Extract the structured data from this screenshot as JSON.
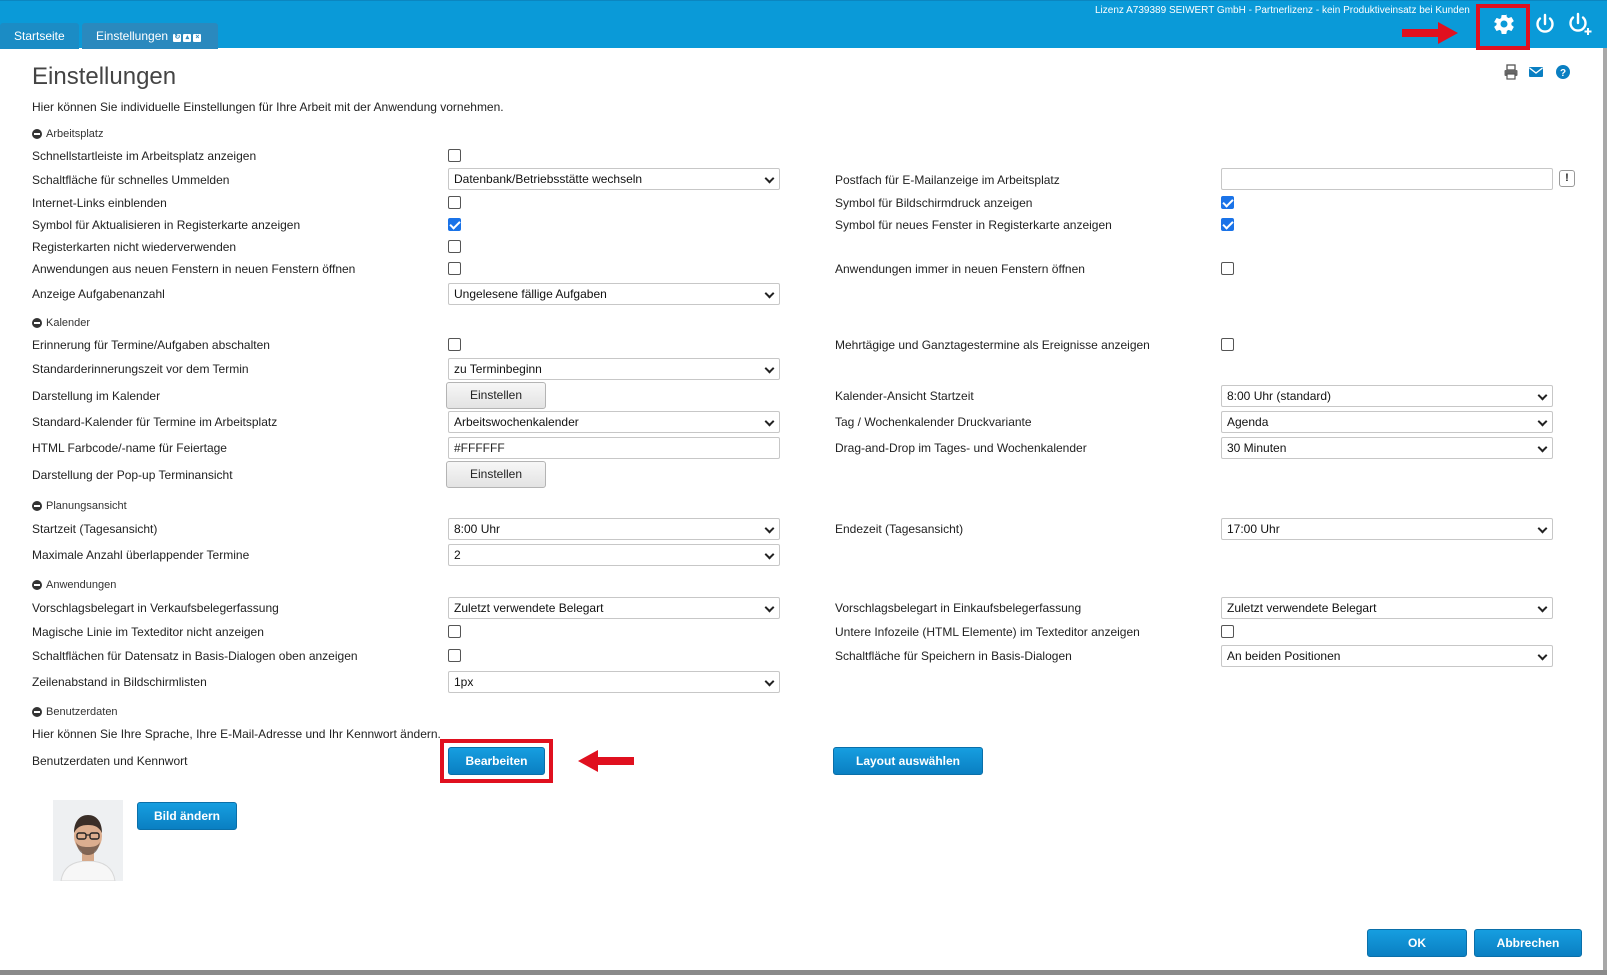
{
  "license_text": "Lizenz A739389 SEIWERT GmbH - Partnerlizenz - kein Produktiveinsatz bei Kunden",
  "tabs": [
    {
      "label": "Startseite"
    },
    {
      "label": "Einstellungen"
    }
  ],
  "header": {
    "title": "Einstellungen",
    "description": "Hier können Sie individuelle Einstellungen für Ihre Arbeit mit der Anwendung vornehmen."
  },
  "sections": {
    "arbeitsplatz": "Arbeitsplatz",
    "kalender": "Kalender",
    "planung": "Planungsansicht",
    "anwendungen": "Anwendungen",
    "benutzer": "Benutzerdaten"
  },
  "rows": {
    "schnellstart": {
      "label": "Schnellstartleiste im Arbeitsplatz anzeigen",
      "checked": false
    },
    "ummelden": {
      "label": "Schaltfläche für schnelles Ummelden",
      "value": "Datenbank/Betriebsstätte wechseln"
    },
    "postfach": {
      "label": "Postfach für E-Mailanzeige im Arbeitsplatz",
      "value": ""
    },
    "internet_links": {
      "label": "Internet-Links einblenden",
      "checked": false
    },
    "bildschirmdruck": {
      "label": "Symbol für Bildschirmdruck anzeigen",
      "checked": true
    },
    "aktualisieren": {
      "label": "Symbol für Aktualisieren in Registerkarte anzeigen",
      "checked": true
    },
    "neues_fenster": {
      "label": "Symbol für neues Fenster in Registerkarte anzeigen",
      "checked": true
    },
    "registerkarten": {
      "label": "Registerkarten nicht wiederverwenden",
      "checked": false
    },
    "anw_neue_fenster": {
      "label": "Anwendungen aus neuen Fenstern in neuen Fenstern öffnen",
      "checked": false
    },
    "anw_immer_neu": {
      "label": "Anwendungen immer in neuen Fenstern öffnen",
      "checked": false
    },
    "aufgabenanzahl": {
      "label": "Anzeige Aufgabenanzahl",
      "value": "Ungelesene fällige Aufgaben"
    },
    "erinnerung": {
      "label": "Erinnerung für Termine/Aufgaben abschalten",
      "checked": false
    },
    "mehrtaegig": {
      "label": "Mehrtägige und Ganztagestermine als Ereignisse anzeigen",
      "checked": false
    },
    "std_erinnerung": {
      "label": "Standarderinnerungszeit vor dem Termin",
      "value": "zu Terminbeginn"
    },
    "darstellung_kal": {
      "label": "Darstellung im Kalender",
      "button": "Einstellen"
    },
    "kal_startzeit": {
      "label": "Kalender-Ansicht Startzeit",
      "value": "8:00 Uhr (standard)"
    },
    "std_kalender": {
      "label": "Standard-Kalender für Termine im Arbeitsplatz",
      "value": "Arbeitswochenkalender"
    },
    "druckvariante": {
      "label": "Tag / Wochenkalender Druckvariante",
      "value": "Agenda"
    },
    "farbcode": {
      "label": "HTML Farbcode/-name für Feiertage",
      "value": "#FFFFFF"
    },
    "dragdrop": {
      "label": "Drag-and-Drop im Tages- und Wochenkalender",
      "value": "30 Minuten"
    },
    "popup": {
      "label": "Darstellung der Pop-up Terminansicht",
      "button": "Einstellen"
    },
    "startzeit": {
      "label": "Startzeit (Tagesansicht)",
      "value": "8:00 Uhr"
    },
    "endezeit": {
      "label": "Endezeit (Tagesansicht)",
      "value": "17:00 Uhr"
    },
    "max_ueberlapp": {
      "label": "Maximale Anzahl überlappender Termine",
      "value": "2"
    },
    "vk_beleg": {
      "label": "Vorschlagsbelegart in Verkaufsbelegerfassung",
      "value": "Zuletzt verwendete Belegart"
    },
    "ek_beleg": {
      "label": "Vorschlagsbelegart in Einkaufsbelegerfassung",
      "value": "Zuletzt verwendete Belegart"
    },
    "magische_linie": {
      "label": "Magische Linie im Texteditor nicht anzeigen",
      "checked": false
    },
    "infozeile": {
      "label": "Untere Infozeile (HTML Elemente) im Texteditor anzeigen",
      "checked": false
    },
    "datensatz_oben": {
      "label": "Schaltflächen für Datensatz in Basis-Dialogen oben anzeigen",
      "checked": false
    },
    "speichern_pos": {
      "label": "Schaltfläche für Speichern in Basis-Dialogen",
      "value": "An beiden Positionen"
    },
    "zeilenabstand": {
      "label": "Zeilenabstand in Bildschirmlisten",
      "value": "1px"
    }
  },
  "benutzer": {
    "hint": "Hier können Sie Ihre Sprache, Ihre E-Mail-Adresse und Ihr Kennwort ändern.",
    "label": "Benutzerdaten und Kennwort",
    "edit_button": "Bearbeiten",
    "layout_button": "Layout auswählen",
    "picture_button": "Bild ändern"
  },
  "footer": {
    "ok": "OK",
    "cancel": "Abbrechen"
  },
  "colors": {
    "topbar": "#0a9ad8",
    "primary_button": "#0a7fc2",
    "annotation": "#e0101f",
    "checked": "#1a73e8"
  }
}
